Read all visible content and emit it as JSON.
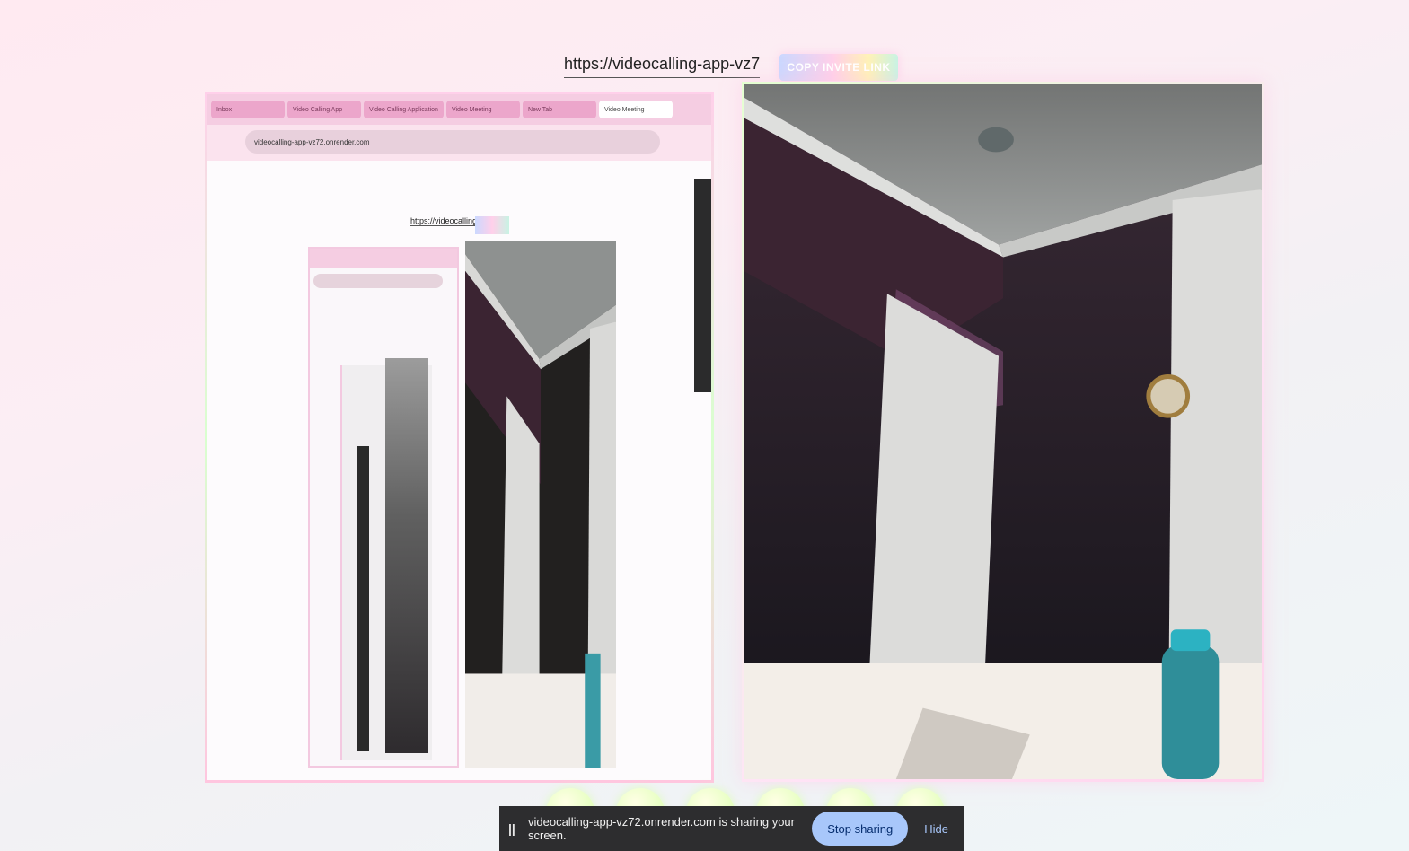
{
  "invite": {
    "url_value": "https://videocalling-app-vz7",
    "copy_label": "COPY INVITE LINK"
  },
  "shared_screen": {
    "tabs": [
      {
        "label": "Inbox"
      },
      {
        "label": "Video Calling App"
      },
      {
        "label": "Video Calling Application"
      },
      {
        "label": "Video Meeting"
      },
      {
        "label": "New Tab"
      },
      {
        "label": "Video Meeting"
      }
    ],
    "address": "videocalling-app-vz72.onrender.com",
    "inner_url": "https://videocalling-app-vz7"
  },
  "banner": {
    "pause_icon": "pause-icon",
    "message": "videocalling-app-vz72.onrender.com is sharing your screen.",
    "stop_label": "Stop sharing",
    "hide_label": "Hide"
  },
  "colors": {
    "banner_bg": "#2d2d2f",
    "stop_button": "#a8c7fa",
    "hide_link": "#a8c7fa",
    "page_bg": "#ffeaf1"
  }
}
